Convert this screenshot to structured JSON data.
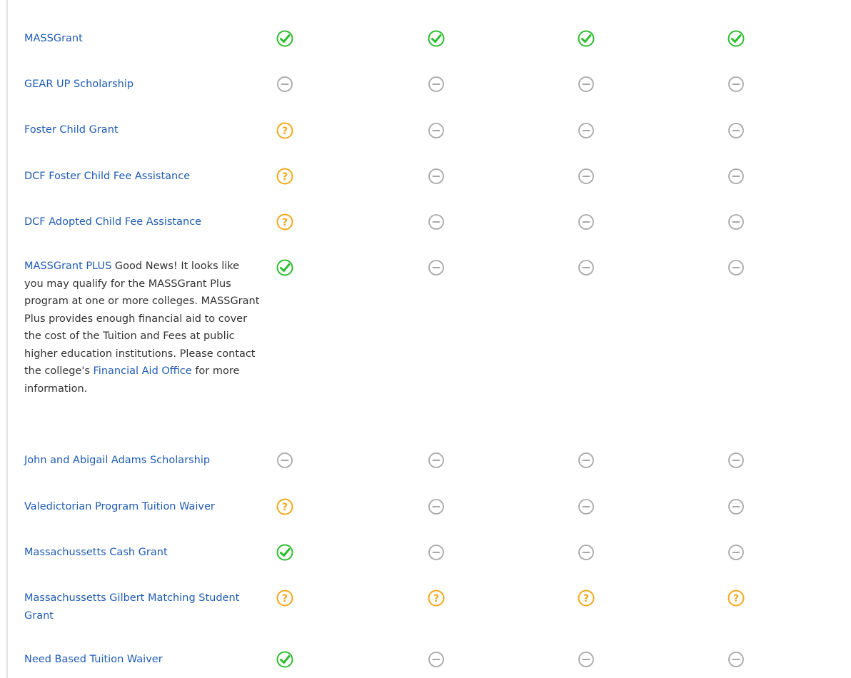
{
  "status_colors": {
    "eligible": "#2ebd2e",
    "maybe": "#f2a91b",
    "not_eligible": "#a8a8a8"
  },
  "rows": [
    {
      "name": "MASSGrant",
      "status": [
        "eligible",
        "eligible",
        "eligible",
        "eligible"
      ]
    },
    {
      "name": "GEAR UP Scholarship",
      "status": [
        "not_eligible",
        "not_eligible",
        "not_eligible",
        "not_eligible"
      ]
    },
    {
      "name": "Foster Child Grant",
      "status": [
        "maybe",
        "not_eligible",
        "not_eligible",
        "not_eligible"
      ]
    },
    {
      "name": "DCF Foster Child Fee Assistance",
      "status": [
        "maybe",
        "not_eligible",
        "not_eligible",
        "not_eligible"
      ]
    },
    {
      "name": "DCF Adopted Child Fee Assistance",
      "status": [
        "maybe",
        "not_eligible",
        "not_eligible",
        "not_eligible"
      ]
    },
    {
      "name": "MASSGrant PLUS",
      "note_before": " Good News! It looks like you may qualify for the MASSGrant Plus program at one or more colleges. MASSGrant Plus provides enough financial aid to cover the cost of the Tuition and Fees at public higher education institutions. Please contact the college's ",
      "note_link": "Financial Aid Office",
      "note_after": " for more information.",
      "status": [
        "eligible",
        "not_eligible",
        "not_eligible",
        "not_eligible"
      ]
    },
    {
      "name": "John and Abigail Adams Scholarship",
      "status": [
        "not_eligible",
        "not_eligible",
        "not_eligible",
        "not_eligible"
      ]
    },
    {
      "name": "Valedictorian Program Tuition Waiver",
      "status": [
        "maybe",
        "not_eligible",
        "not_eligible",
        "not_eligible"
      ]
    },
    {
      "name": "Massachussetts Cash Grant",
      "status": [
        "eligible",
        "not_eligible",
        "not_eligible",
        "not_eligible"
      ]
    },
    {
      "name": "Massachussetts Gilbert Matching Student Grant",
      "status": [
        "maybe",
        "maybe",
        "maybe",
        "maybe"
      ]
    },
    {
      "name": "Need Based Tuition Waiver",
      "status": [
        "eligible",
        "not_eligible",
        "not_eligible",
        "not_eligible"
      ]
    }
  ]
}
